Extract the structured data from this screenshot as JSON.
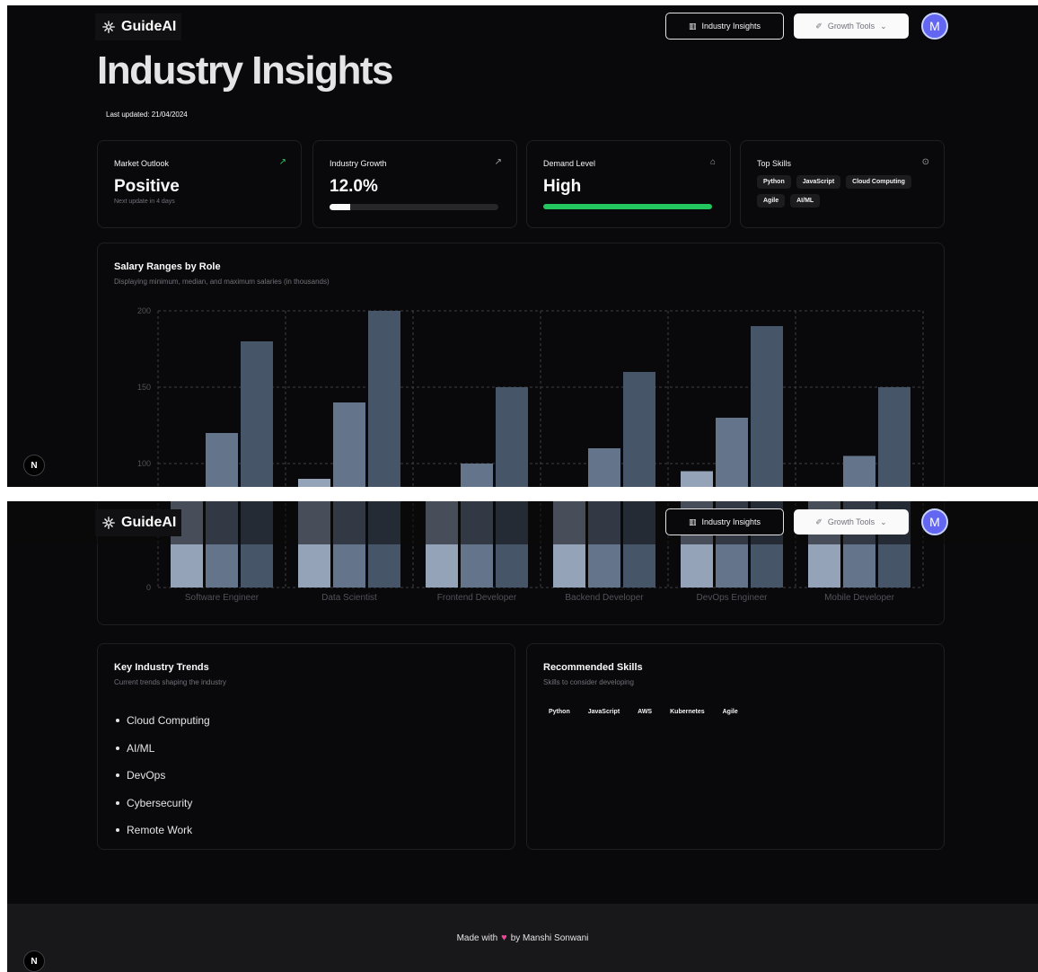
{
  "app": {
    "name": "GuideAI"
  },
  "header": {
    "insights_label": "Industry Insights",
    "growth_label": "Growth Tools",
    "avatar_initial": "M"
  },
  "page": {
    "title": "Industry Insights",
    "last_updated": "Last updated: 21/04/2024"
  },
  "stats": {
    "market_outlook": {
      "title": "Market Outlook",
      "value": "Positive",
      "sub": "Next update in 4 days",
      "icon": "trend-up-icon"
    },
    "industry_growth": {
      "title": "Industry Growth",
      "value": "12.0%",
      "progress": 0.12,
      "icon": "trend-up-icon"
    },
    "demand_level": {
      "title": "Demand Level",
      "value": "High",
      "progress": 1.0,
      "icon": "briefcase-icon"
    },
    "top_skills": {
      "title": "Top Skills",
      "icon": "brain-icon",
      "tags": [
        "Python",
        "JavaScript",
        "Cloud Computing",
        "Agile",
        "AI/ML"
      ]
    }
  },
  "chart_section": {
    "title": "Salary Ranges by Role",
    "subtitle": "Displaying minimum, median, and maximum salaries (in thousands)"
  },
  "chart_data": {
    "type": "bar",
    "categories": [
      "Software Engineer",
      "Data Scientist",
      "Frontend Developer",
      "Backend Developer",
      "DevOps Engineer",
      "Mobile Developer"
    ],
    "series": [
      {
        "values": [
          80,
          90,
          70,
          75,
          95,
          70
        ]
      },
      {
        "values": [
          120,
          140,
          100,
          110,
          130,
          105
        ]
      },
      {
        "values": [
          180,
          200,
          150,
          160,
          190,
          150
        ]
      }
    ],
    "ylim": [
      0,
      200
    ],
    "yticks": [
      0,
      100,
      150,
      200
    ],
    "grid": true,
    "colors": [
      "#94a3b8",
      "#64748b",
      "#475569"
    ]
  },
  "trends": {
    "title": "Key Industry Trends",
    "subtitle": "Current trends shaping the industry",
    "items": [
      "Cloud Computing",
      "AI/ML",
      "DevOps",
      "Cybersecurity",
      "Remote Work"
    ]
  },
  "recommended": {
    "title": "Recommended Skills",
    "subtitle": "Skills to consider developing",
    "tags": [
      "Python",
      "JavaScript",
      "AWS",
      "Kubernetes",
      "Agile"
    ]
  },
  "footer": {
    "prefix": "Made with",
    "suffix": "by Manshi Sonwani"
  },
  "badge": {
    "letter": "N"
  },
  "colors": {
    "accent": "#6366f1",
    "demand": "#22c55e",
    "progress": "#fafafa"
  }
}
